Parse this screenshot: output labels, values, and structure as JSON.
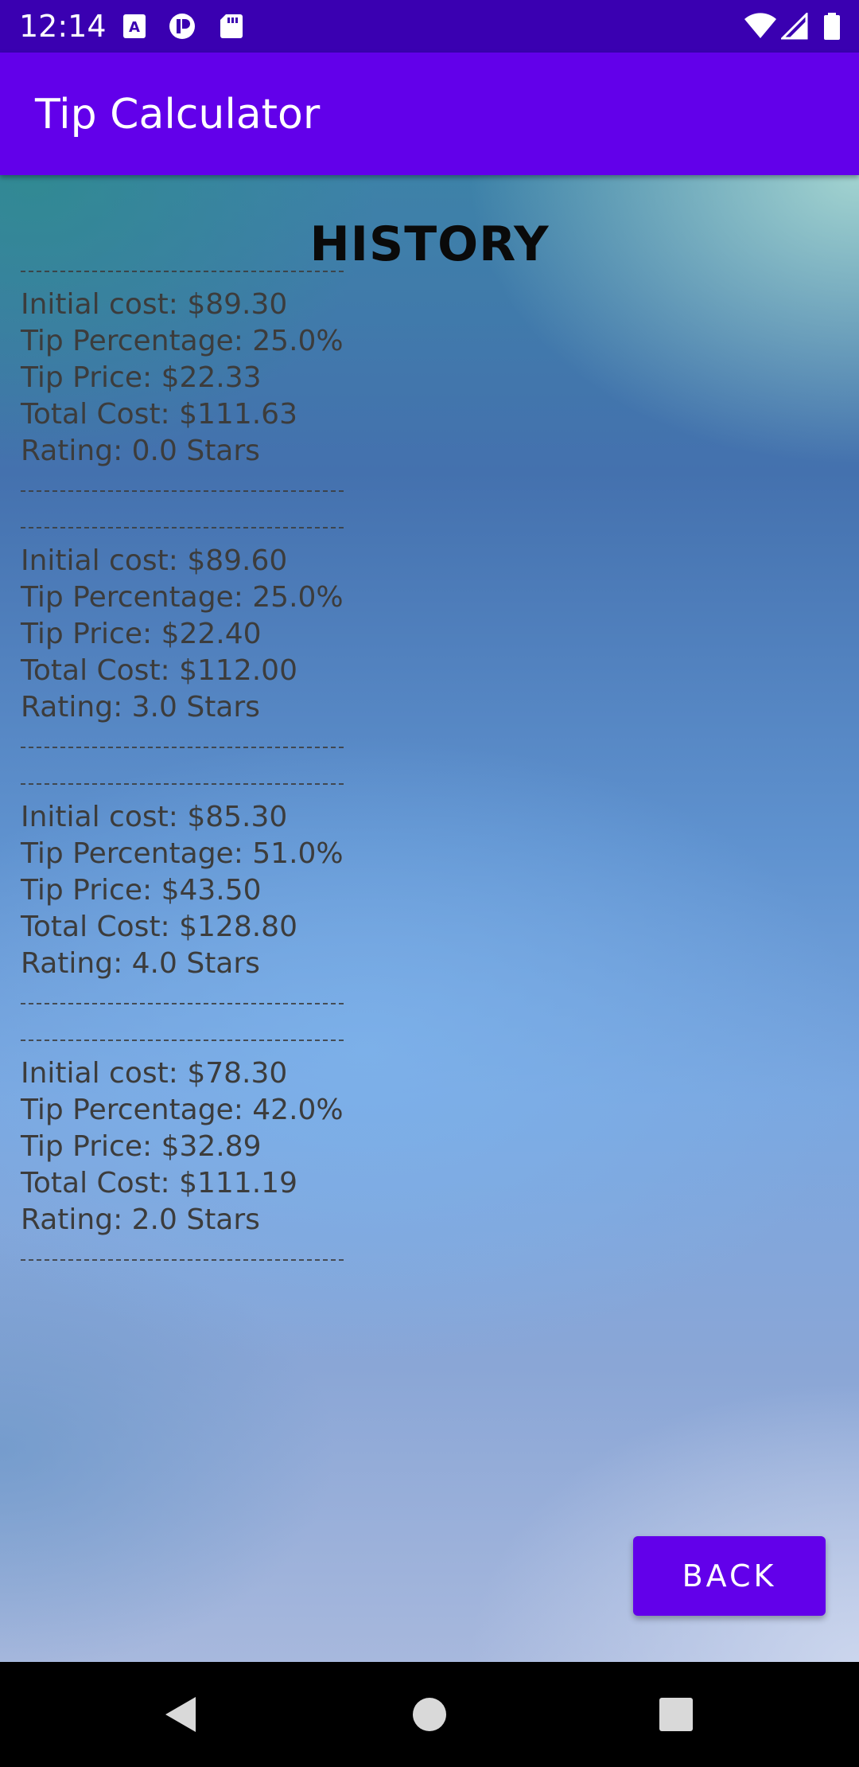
{
  "status_bar": {
    "time": "12:14",
    "left_icons": [
      "a-notification-icon",
      "p-notification-icon",
      "sd-card-icon"
    ],
    "right_icons": [
      "wifi-icon",
      "cell-signal-icon",
      "battery-icon"
    ]
  },
  "app_bar": {
    "title": "Tip Calculator",
    "color": "#6200ea"
  },
  "history": {
    "title": "HISTORY",
    "separator": "--------------------------------",
    "entries": [
      {
        "initial_cost": "Initial cost: $89.30",
        "tip_percentage": "Tip Percentage: 25.0%",
        "tip_price": "Tip Price: $22.33",
        "total_cost": "Total Cost: $111.63",
        "rating": "Rating: 0.0 Stars"
      },
      {
        "initial_cost": "Initial cost: $89.60",
        "tip_percentage": "Tip Percentage: 25.0%",
        "tip_price": "Tip Price: $22.40",
        "total_cost": "Total Cost: $112.00",
        "rating": "Rating: 3.0 Stars"
      },
      {
        "initial_cost": "Initial cost: $85.30",
        "tip_percentage": "Tip Percentage: 51.0%",
        "tip_price": "Tip Price: $43.50",
        "total_cost": "Total Cost: $128.80",
        "rating": "Rating: 4.0 Stars"
      },
      {
        "initial_cost": "Initial cost: $78.30",
        "tip_percentage": "Tip Percentage: 42.0%",
        "tip_price": "Tip Price: $32.89",
        "total_cost": "Total Cost: $111.19",
        "rating": "Rating: 2.0 Stars"
      }
    ]
  },
  "actions": {
    "back_label": "BACK"
  },
  "nav_bar": {
    "icons": [
      "back-triangle-icon",
      "home-circle-icon",
      "recents-square-icon"
    ]
  },
  "colors": {
    "status_bar": "#3a00b1",
    "accent": "#6200ea",
    "text": "#3c3c3c",
    "title_text": "#0a0a0a"
  }
}
